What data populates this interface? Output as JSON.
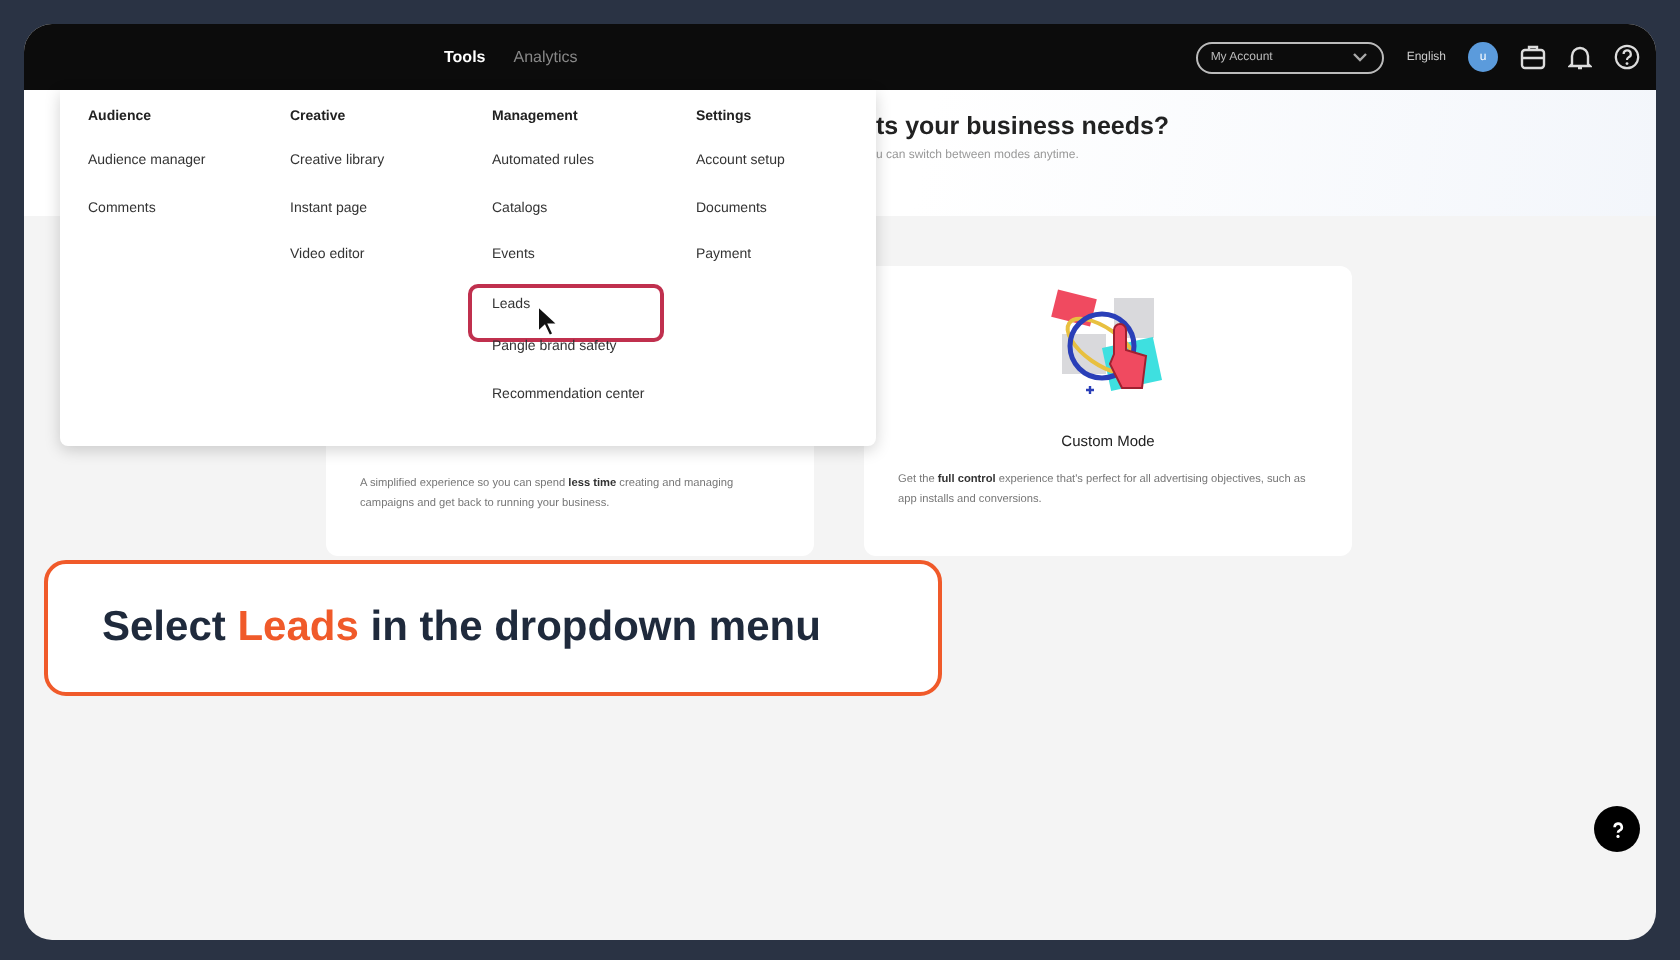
{
  "nav": {
    "items": [
      {
        "label": "Tools",
        "active": true
      },
      {
        "label": "Analytics",
        "active": false
      }
    ],
    "account": {
      "placeholder": "My Account"
    },
    "language": "English",
    "avatar": "u"
  },
  "hero": {
    "heading": "ts your business needs?",
    "subtitle": "u can switch between modes anytime."
  },
  "menu": {
    "columns": [
      {
        "heading": "Audience",
        "items": [
          {
            "label": "Audience manager",
            "highlighted": false
          },
          {
            "label": "Comments",
            "highlighted": false
          }
        ]
      },
      {
        "heading": "Creative",
        "items": [
          {
            "label": "Creative library",
            "highlighted": false
          },
          {
            "label": "Instant page",
            "highlighted": false
          },
          {
            "label": "Video editor",
            "highlighted": false
          }
        ]
      },
      {
        "heading": "Management",
        "items": [
          {
            "label": "Automated rules",
            "highlighted": false
          },
          {
            "label": "Catalogs",
            "highlighted": false
          },
          {
            "label": "Events",
            "highlighted": false
          },
          {
            "label": "Leads",
            "highlighted": true
          },
          {
            "label": "Pangle brand safety",
            "highlighted": false
          },
          {
            "label": "Recommendation center",
            "highlighted": false
          }
        ]
      },
      {
        "heading": "Settings",
        "items": [
          {
            "label": "Account setup",
            "highlighted": false
          },
          {
            "label": "Documents",
            "highlighted": false
          },
          {
            "label": "Payment",
            "highlighted": false
          }
        ]
      }
    ]
  },
  "cards": [
    {
      "kind": "plain",
      "description": "A simplified experience so you can spend **less time** creating and managing campaigns and get back to running your business."
    },
    {
      "kind": "illustrated",
      "title": "Custom Mode",
      "description": "Get the **full control** experience that's perfect for all advertising objectives, such as app installs and conversions."
    }
  ],
  "callout": {
    "before": "Select ",
    "highlight": "Leads",
    "after": " in the dropdown menu"
  }
}
